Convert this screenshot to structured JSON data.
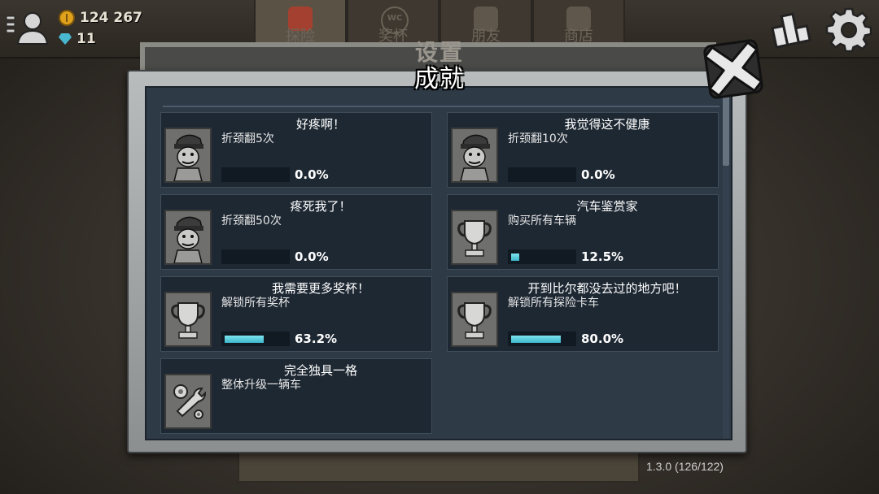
{
  "hud": {
    "coins": "124 267",
    "gems": "11",
    "tabs": [
      "探险",
      "奖杯",
      "朋友",
      "商店"
    ],
    "tabs_badge": "WC"
  },
  "settings": {
    "title": "设置"
  },
  "panel": {
    "title": "成就"
  },
  "achievements": [
    {
      "title": "好疼啊！",
      "desc": "折颈翻5次",
      "progress": "0.0%",
      "fill": 0.0,
      "icon": "driver-portrait-icon"
    },
    {
      "title": "我觉得这不健康",
      "desc": "折颈翻10次",
      "progress": "0.0%",
      "fill": 0.0,
      "icon": "driver-portrait-icon"
    },
    {
      "title": "疼死我了！",
      "desc": "折颈翻50次",
      "progress": "0.0%",
      "fill": 0.0,
      "icon": "driver-portrait-icon"
    },
    {
      "title": "汽车鉴赏家",
      "desc": "购买所有车辆",
      "progress": "12.5%",
      "fill": 0.125,
      "icon": "trophy-icon"
    },
    {
      "title": "我需要更多奖杯！",
      "desc": "解锁所有奖杯",
      "progress": "63.2%",
      "fill": 0.632,
      "icon": "trophy-icon"
    },
    {
      "title": "开到比尔都没去过的地方吧！",
      "desc": "解锁所有探险卡车",
      "progress": "80.0%",
      "fill": 0.8,
      "icon": "trophy-icon"
    },
    {
      "title": "完全独具一格",
      "desc": "整体升级一辆车",
      "progress": "",
      "fill": null,
      "icon": "wrench-gear-icon"
    }
  ],
  "version": "1.3.0 (126/122)",
  "colors": {
    "panel_bg": "#2f3a47",
    "card_bg": "#1e2833",
    "progress_fill": "#4cc7d8",
    "frame": "#b9bcbd"
  }
}
